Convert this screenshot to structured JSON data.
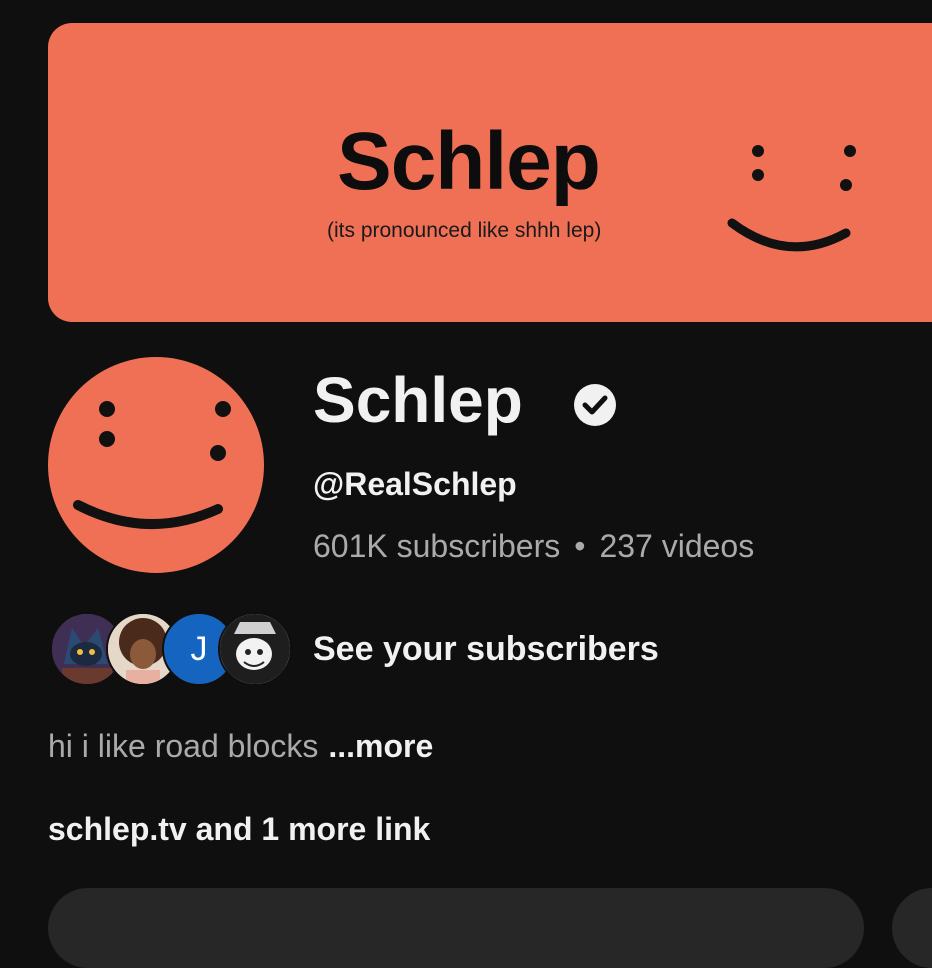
{
  "banner": {
    "title": "Schlep",
    "subtitle": "(its pronounced like shhh lep)"
  },
  "channel": {
    "name": "Schlep",
    "handle": "@RealSchlep",
    "subscribers": "601K subscribers",
    "separator": "•",
    "videos": "237 videos"
  },
  "subscribers_preview": {
    "avatar_initial": "J",
    "label": "See your subscribers"
  },
  "description": {
    "text": "hi i like road blocks",
    "more_label": "...more"
  },
  "links": {
    "label": "schlep.tv and 1 more link"
  },
  "colors": {
    "background": "#0f0f0f",
    "brand": "#f07055",
    "text_primary": "#f1f1f1",
    "text_secondary": "#aaaaaa",
    "button_bg": "#272727",
    "initial_avatar": "#1565c0"
  }
}
